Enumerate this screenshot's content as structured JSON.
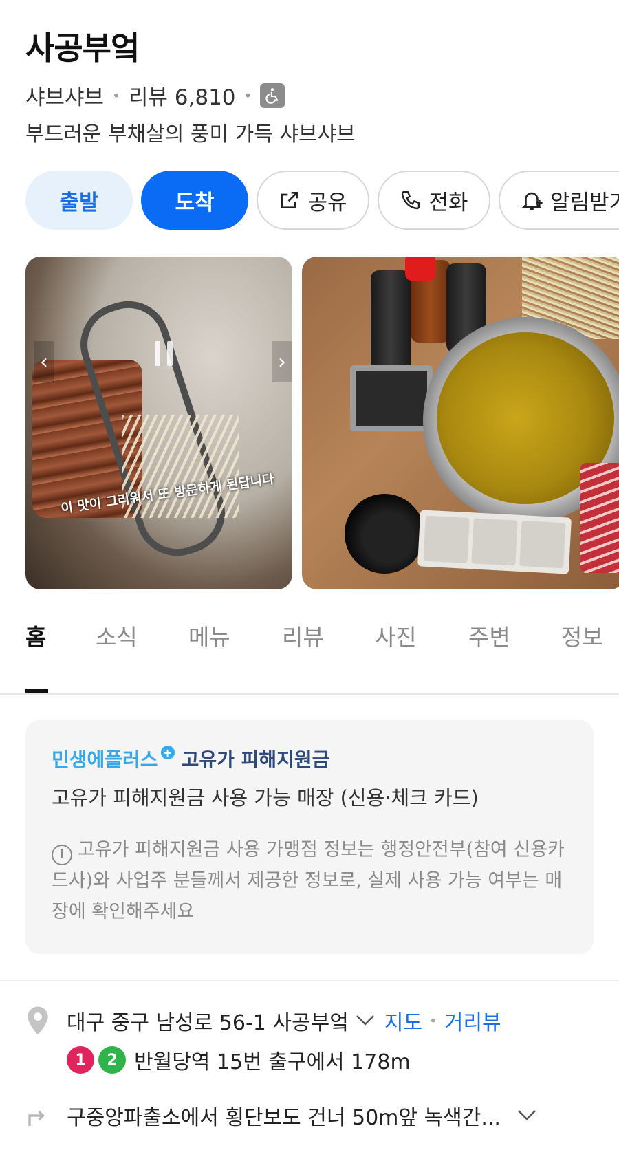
{
  "place": {
    "name": "사공부엌",
    "category": "샤브샤브",
    "review_label": "리뷰 6,810",
    "accessibility_icon": "wheelchair-icon",
    "description": "부드러운 부채살의 풍미 가득 샤브샤브"
  },
  "actions": {
    "depart": "출발",
    "arrive": "도착",
    "share": "공유",
    "call": "전화",
    "alert": "알림받기"
  },
  "photos": {
    "caption": "이 맛이 그리워서 또 방문하게 된답니다"
  },
  "tabs": [
    "홈",
    "소식",
    "메뉴",
    "리뷰",
    "사진",
    "주변",
    "정보"
  ],
  "active_tab": "홈",
  "promo": {
    "brand_part1": "민생에플러스",
    "brand_part2": "고유가 피해지원금",
    "title": "고유가 피해지원금 사용 가능 매장 (신용·체크 카드)",
    "note": "고유가 피해지원금 사용 가맹점 정보는 행정안전부(참여 신용카드사)와 사업주 분들께서 제공한 정보로, 실제 사용 가능 여부는 매장에 확인해주세요"
  },
  "location": {
    "address": "대구 중구 남성로 56-1 사공부엌",
    "map_link": "지도",
    "street_view_link": "거리뷰",
    "line1": "1",
    "line2": "2",
    "station_text": "반월당역 15번 출구에서 178m",
    "directions": "구중앙파출소에서 횡단보도 건너 50m앞 녹색간..."
  },
  "colors": {
    "accent": "#0a6cf5",
    "accent_light": "#e6f1fc",
    "line1": "#e0245e",
    "line2": "#2fb34a"
  }
}
